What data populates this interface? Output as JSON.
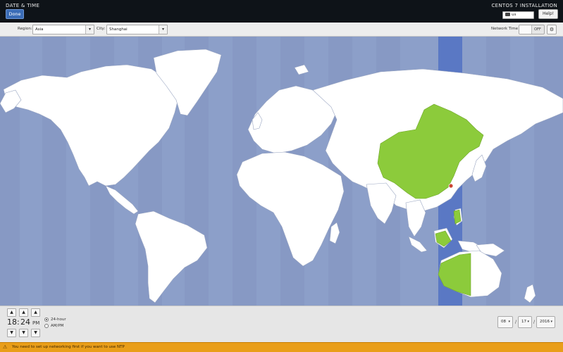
{
  "header": {
    "spoke_title": "DATE & TIME",
    "done_label": "Done",
    "product_title": "CENTOS 7 INSTALLATION",
    "keyboard_layout": "us",
    "help_label": "Help!"
  },
  "toolbar": {
    "region_label": "Region:",
    "region_value": "Asia",
    "city_label": "City:",
    "city_value": "Shanghai",
    "network_time_label": "Network Time",
    "network_time_state": "OFF"
  },
  "map": {
    "ocean_color": "#8c9fc9",
    "land_color": "#ffffff",
    "selected_zone_color": "#8ccb3b",
    "selected_band_color": "#5a78c4",
    "selected_city": "Shanghai"
  },
  "time": {
    "hours": "18",
    "separator": ":",
    "minutes": "24",
    "ampm": "PM",
    "format_24h_label": "24-hour",
    "format_ampm_label": "AM/PM",
    "format_selected": "24-hour"
  },
  "date": {
    "month": "08",
    "day": "17",
    "year": "2016",
    "separator": "/"
  },
  "warning": {
    "icon": "warning-icon",
    "text": "You need to set up networking first if you want to use NTP"
  }
}
